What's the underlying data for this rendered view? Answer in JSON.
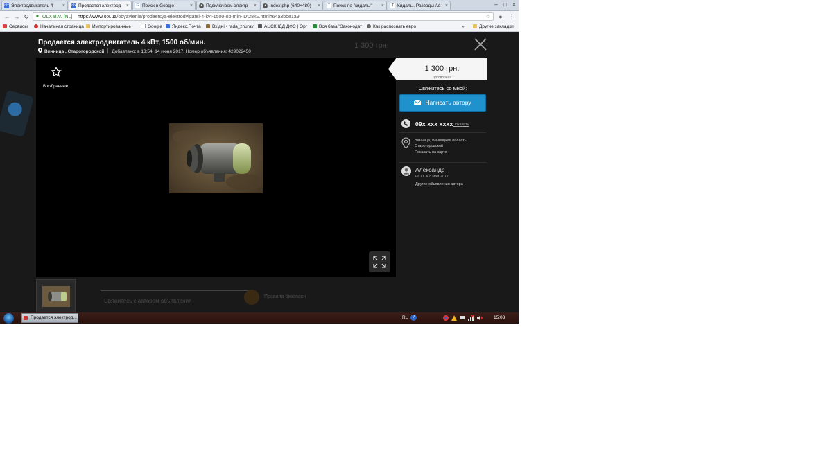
{
  "browser": {
    "tabs": [
      {
        "label": "Электродвигатель 4",
        "icon_text": "olx"
      },
      {
        "label": "Продается электрод",
        "icon_text": "olx"
      },
      {
        "label": "Поиск в Google",
        "icon_text": "G"
      },
      {
        "label": "Подключаем электр",
        "icon_text": "•"
      },
      {
        "label": "index.php (640×480)",
        "icon_text": "•"
      },
      {
        "label": "Поиск по \"кидалы\"",
        "icon_text": "T"
      },
      {
        "label": "Кидалы. Разводы Ав",
        "icon_text": "T"
      }
    ],
    "tab_close": "×",
    "window_controls": [
      "–",
      "□",
      "×"
    ],
    "site_identity": "OLX B.V. [NL]",
    "url_prefix": "https://www.olx.ua",
    "url_path": "/obyavlenie/prodaetsya-elektrodvigatel-4-kvt-1500-ob-min-IDt28kV.html#64a3bbe1a9",
    "bookmarks": [
      "Сервисы",
      "Начальная страница",
      "Импортированные",
      "Google",
      "Яндекс.Почта",
      "Вхідні • rada_zhurav",
      "АЦСК ІДД ДФС | Орг",
      "Вся база \"Законодат",
      "Как распознать евро"
    ],
    "bookmarks_overflow": "»",
    "other_bookmarks": "Другие закладки"
  },
  "listing": {
    "title": "Продается электродвигатель 4 кВт, 1500 об/мин.",
    "location": "Винница , Старогородской",
    "added": "Добавлено: в 13:54, 14 июня 2017, Номер объявления: 429022450",
    "favorite_label": "В избранные"
  },
  "sidebar": {
    "price": "1 300 грн.",
    "negotiable": "Договорная",
    "contact_title": "Свяжитесь со мной:",
    "write_button": "Написать автору",
    "phone": "09x xxx xxxx",
    "show_phone": "Показать",
    "location": "Винница, Винницкая область, Старогородской",
    "show_on_map": "Показать на карте",
    "author_name": "Александр",
    "author_since": "на OLX с мая 2017",
    "author_other": "Другие объявления автора"
  },
  "background": {
    "price": "1 300 грн.",
    "contact_text": "Свяжитесь с автором объявления",
    "safety_text": "Правила безопасн"
  },
  "taskbar": {
    "window_item": "Продается электрод...",
    "language": "RU",
    "help": "?",
    "time": "15:03"
  },
  "colors": {
    "accent_button": "#1f92ce",
    "page_bg": "#191919",
    "viewer_bg": "#000000"
  }
}
